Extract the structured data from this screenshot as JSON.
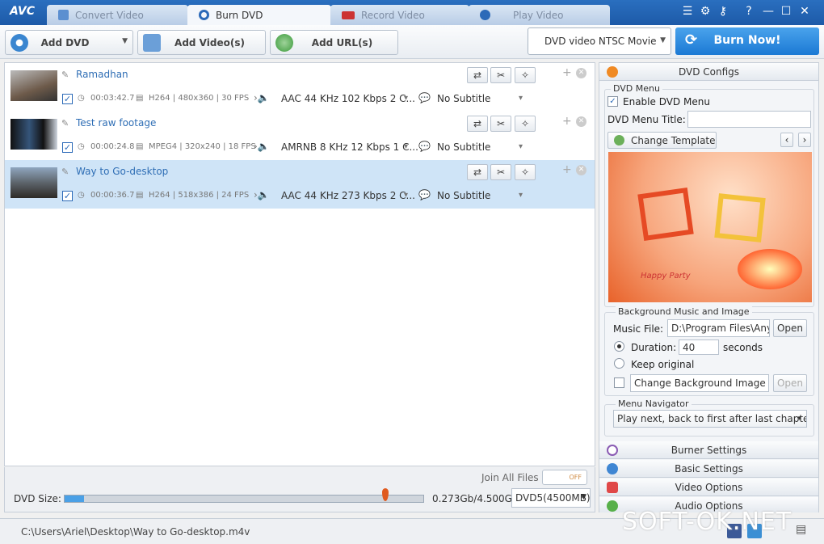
{
  "app": {
    "logo": "AVC"
  },
  "tabs": [
    {
      "label": "Convert Video",
      "icon": "convert-video-icon",
      "active": false
    },
    {
      "label": "Burn DVD",
      "icon": "burn-dvd-icon",
      "active": true
    },
    {
      "label": "Record Video",
      "icon": "record-video-icon",
      "active": false
    },
    {
      "label": "Play Video",
      "icon": "play-video-icon",
      "active": false
    }
  ],
  "toolbar": {
    "add_dvd": "Add DVD",
    "add_videos": "Add Video(s)",
    "add_url": "Add URL(s)",
    "profile": "DVD video NTSC Movie",
    "burn_now": "Burn Now!"
  },
  "files": [
    {
      "name": "Ramadhan",
      "duration": "00:03:42.7",
      "codec": "H264 | 480x360 | 30 FPS",
      "audio": "AAC 44 KHz 102 Kbps 2 C...",
      "subtitle": "No Subtitle",
      "checked": true,
      "selected": false
    },
    {
      "name": "Test raw footage",
      "duration": "00:00:24.8",
      "codec": "MPEG4 | 320x240 | 18 FPS",
      "audio": "AMRNB 8 KHz 12 Kbps 1 C...",
      "subtitle": "No Subtitle",
      "checked": true,
      "selected": false
    },
    {
      "name": "Way to Go-desktop",
      "duration": "00:00:36.7",
      "codec": "H264 | 518x386 | 24 FPS",
      "audio": "AAC 44 KHz 273 Kbps 2 C...",
      "subtitle": "No Subtitle",
      "checked": true,
      "selected": true
    }
  ],
  "bottom": {
    "join_all": "Join All Files",
    "toggle": "OFF",
    "dvd_size_label": "DVD Size:",
    "size_text": "0.273Gb/4.500Gb",
    "disc": "DVD5(4500MB)",
    "fill_fraction": 0.055,
    "marker_fraction": 0.897
  },
  "panel": {
    "dvd_configs": "DVD Configs",
    "dvd_menu": "DVD Menu",
    "enable_menu": "Enable DVD Menu",
    "menu_title_label": "DVD Menu Title:",
    "menu_title_value": "",
    "change_template": "Change Template",
    "template_caption": "Happy Party",
    "bg_group": "Background Music and Image",
    "music_file_label": "Music File:",
    "music_file_value": "D:\\Program Files\\Any V",
    "open": "Open",
    "duration_label": "Duration:",
    "duration_value": "40",
    "seconds": "seconds",
    "keep_original": "Keep original",
    "change_bg": "Change Background Image",
    "open2": "Open",
    "nav_group": "Menu Navigator",
    "nav_value": "Play next, back to first after last chapter",
    "burner_settings": "Burner Settings",
    "basic_settings": "Basic Settings",
    "video_options": "Video Options",
    "audio_options": "Audio Options"
  },
  "status": {
    "path": "C:\\Users\\Ariel\\Desktop\\Way to Go-desktop.m4v"
  },
  "watermark": "SOFT-OK.NET",
  "colors": {
    "accent": "#1d5aa8",
    "selected_row": "#cfe4f7",
    "burn": "#1b79d4",
    "progress": "#4aa0e6",
    "marker": "#e05a1e"
  }
}
